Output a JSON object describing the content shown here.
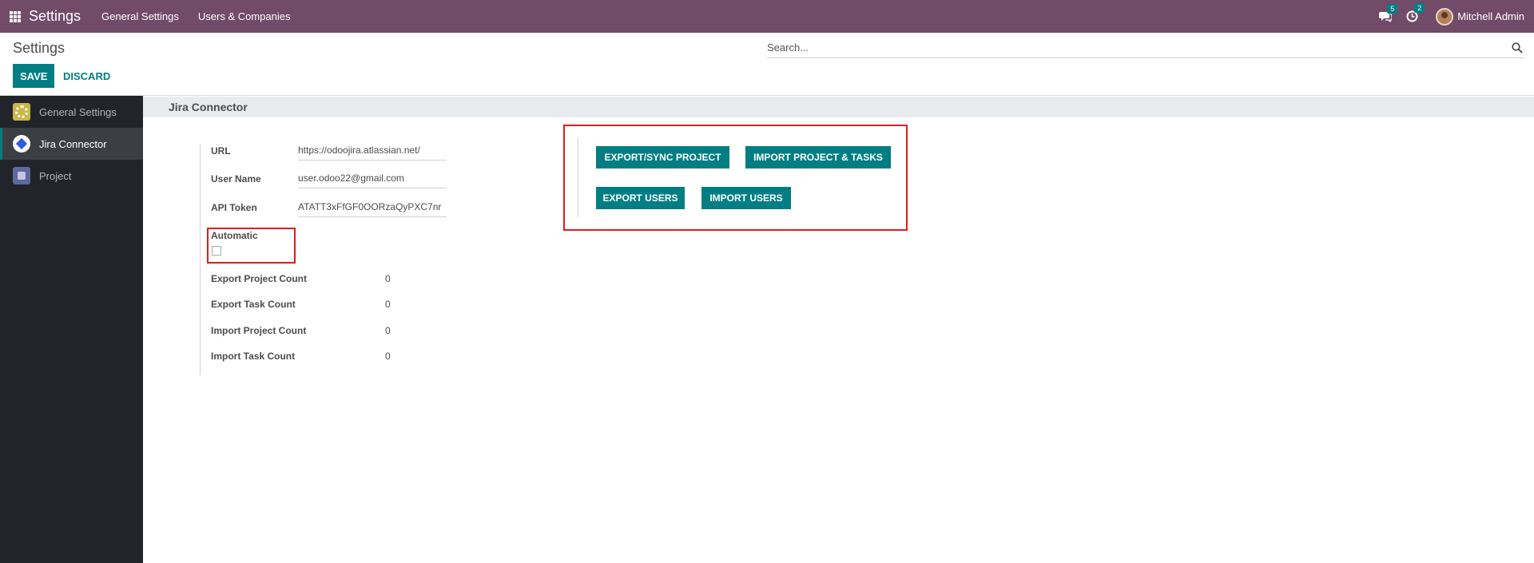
{
  "navbar": {
    "app_title": "Settings",
    "menu": [
      "General Settings",
      "Users & Companies"
    ],
    "messages_badge": "5",
    "activities_badge": "2",
    "user_name": "Mitchell Admin"
  },
  "control_panel": {
    "title": "Settings",
    "search_placeholder": "Search...",
    "save_label": "SAVE",
    "discard_label": "DISCARD"
  },
  "sidebar": {
    "items": [
      {
        "label": "General Settings",
        "icon": "gear-icon"
      },
      {
        "label": "Jira Connector",
        "icon": "jira-icon",
        "active": true
      },
      {
        "label": "Project",
        "icon": "puzzle-icon"
      }
    ]
  },
  "section": {
    "title": "Jira Connector",
    "fields": {
      "url_label": "URL",
      "url_value": "https://odoojira.atlassian.net/",
      "username_label": "User Name",
      "username_value": "user.odoo22@gmail.com",
      "api_token_label": "API Token",
      "api_token_value": "ATATT3xFfGF0OORzaQyPXC7nr",
      "automatic_label": "Automatic",
      "automatic_checked": false
    },
    "counts": [
      {
        "label": "Export Project Count",
        "value": "0"
      },
      {
        "label": "Export Task Count",
        "value": "0"
      },
      {
        "label": "Import Project Count",
        "value": "0"
      },
      {
        "label": "Import Task Count",
        "value": "0"
      }
    ],
    "actions": {
      "export_sync_project": "EXPORT/SYNC PROJECT",
      "import_project_tasks": "IMPORT PROJECT & TASKS",
      "export_users": "EXPORT USERS",
      "import_users": "IMPORT USERS"
    }
  },
  "colors": {
    "navbar": "#714b67",
    "primary": "#017e84",
    "sidebar": "#212529",
    "highlight": "#e11d1d"
  }
}
